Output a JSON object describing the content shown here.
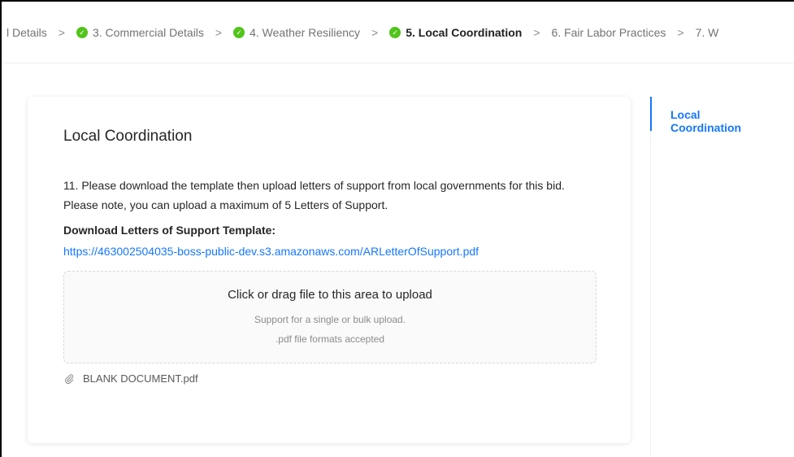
{
  "steps": [
    {
      "label": "l Details",
      "done": false
    },
    {
      "label": "3. Commercial Details",
      "done": true
    },
    {
      "label": "4. Weather Resiliency",
      "done": true
    },
    {
      "label": "5. Local Coordination",
      "done": true,
      "active": true
    },
    {
      "label": "6. Fair Labor Practices",
      "done": false
    },
    {
      "label": "7. W",
      "done": false
    }
  ],
  "separator": ">",
  "card": {
    "title": "Local Coordination",
    "question": "11. Please download the template then upload letters of support from local governments for this bid. Please note, you can upload a maximum of 5 Letters of Support.",
    "download_label": "Download Letters of Support Template:",
    "download_link": "https://463002504035-boss-public-dev.s3.amazonaws.com/ARLetterOfSupport.pdf",
    "dropzone": {
      "text": "Click or drag file to this area to upload",
      "hint1": "Support for a single or bulk upload.",
      "hint2": ".pdf file formats accepted"
    },
    "file_name": "BLANK DOCUMENT.pdf"
  },
  "anchor": {
    "label": "Local Coordination"
  },
  "colors": {
    "accent": "#1677ff",
    "success": "#52c41a"
  }
}
